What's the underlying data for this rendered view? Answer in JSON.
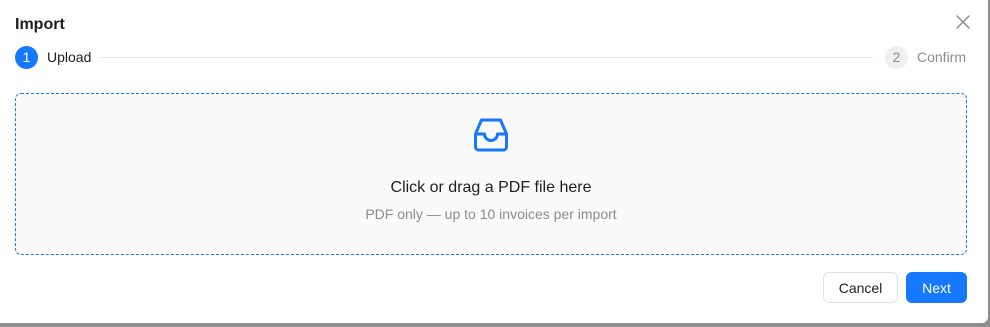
{
  "dialog": {
    "title": "Import"
  },
  "steps": [
    {
      "number": "1",
      "label": "Upload",
      "state": "active"
    },
    {
      "number": "2",
      "label": "Confirm",
      "state": "inactive"
    }
  ],
  "dropzone": {
    "icon": "inbox-icon",
    "text": "Click or drag a PDF file here",
    "hint": "PDF only — up to 10 invoices per import"
  },
  "footer": {
    "cancel_label": "Cancel",
    "next_label": "Next"
  },
  "colors": {
    "accent": "#1677ff",
    "muted": "#8c8c8c"
  }
}
